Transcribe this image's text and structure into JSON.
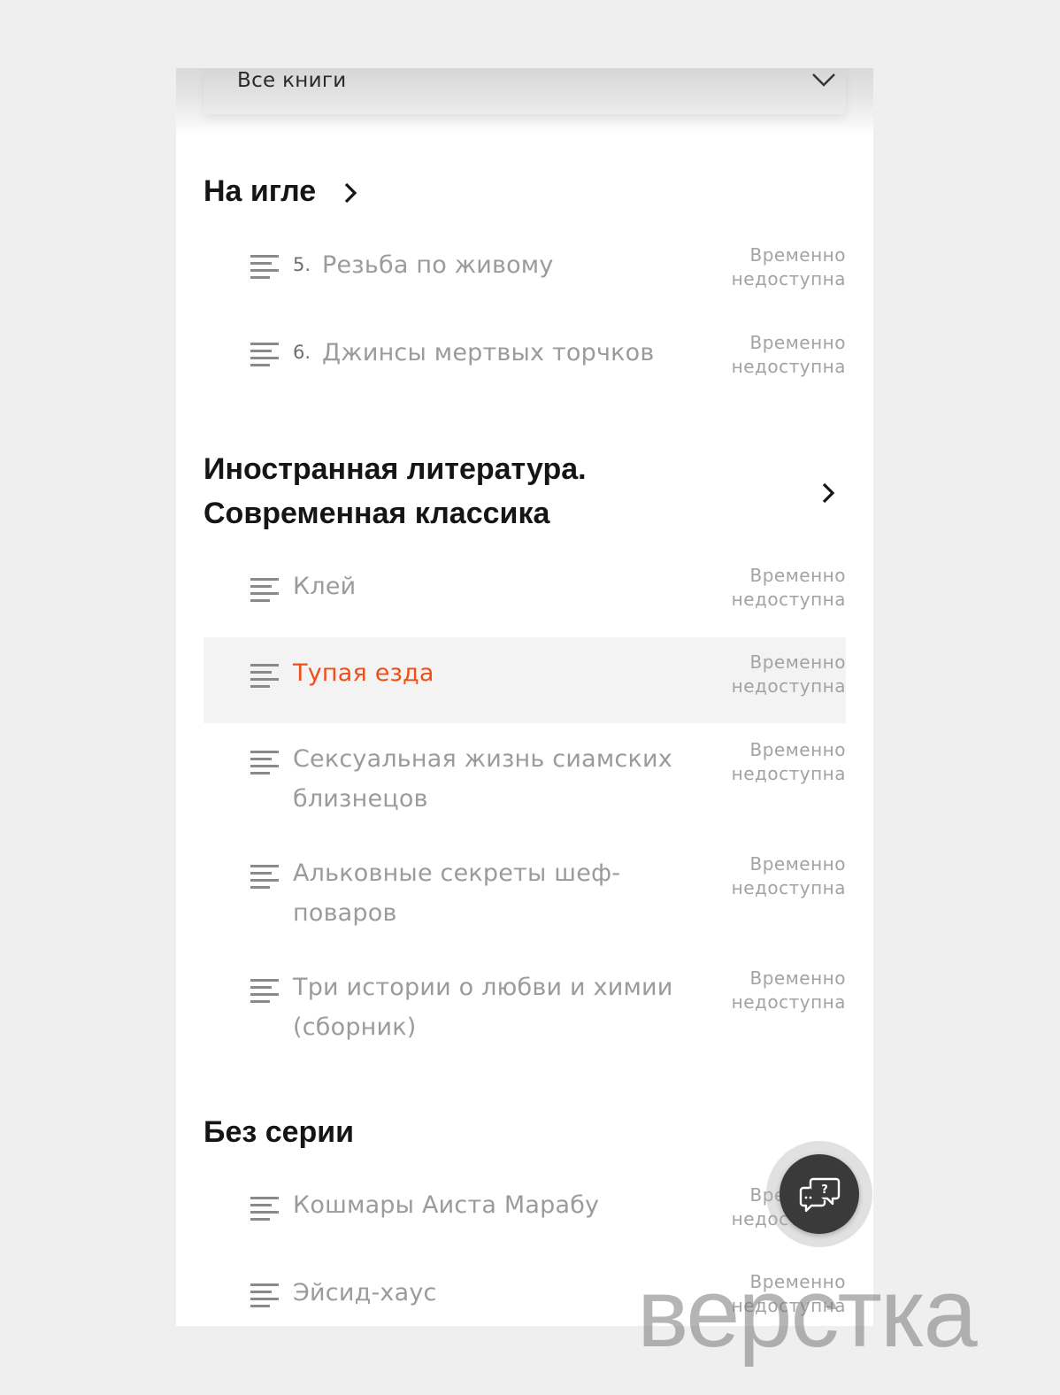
{
  "filter": {
    "label": "Все книги",
    "chevron_icon": "chevron-down-icon"
  },
  "sections": [
    {
      "title": "На игле",
      "items": [
        {
          "number": "5.",
          "title_lines": [
            "Резьба по живому"
          ],
          "status_lines": [
            "Временно",
            "недоступна"
          ]
        },
        {
          "number": "6.",
          "title_lines": [
            "Джинсы мертвых торчков"
          ],
          "status_lines": [
            "Временно",
            "недоступна"
          ]
        }
      ]
    },
    {
      "title_lines": [
        "Иностранная литература.",
        "Современная классика"
      ],
      "items": [
        {
          "title_lines": [
            "Клей"
          ],
          "status_lines": [
            "Временно",
            "недоступна"
          ]
        },
        {
          "title_lines": [
            "Тупая езда"
          ],
          "status_lines": [
            "Временно",
            "недоступна"
          ],
          "active": true
        },
        {
          "title_lines": [
            "Сексуальная жизнь сиамских",
            "близнецов"
          ],
          "status_lines": [
            "Временно",
            "недоступна"
          ]
        },
        {
          "title_lines": [
            "Альковные секреты шеф-",
            "поваров"
          ],
          "status_lines": [
            "Временно",
            "недоступна"
          ]
        },
        {
          "title_lines": [
            "Три истории о любви и химии",
            "(сборник)"
          ],
          "status_lines": [
            "Временно",
            "недоступна"
          ]
        }
      ]
    },
    {
      "title": "Без серии",
      "items": [
        {
          "title_lines": [
            "Кошмары Аиста Марабу"
          ],
          "status_lines": [
            "Временно",
            "недоступна"
          ]
        },
        {
          "title_lines": [
            "Эйсид-хаус"
          ],
          "status_lines": [
            "Временно",
            "недоступна"
          ]
        }
      ]
    }
  ],
  "support_button": {
    "icon": "chat-question-icon"
  },
  "watermark": {
    "text": "верстка"
  },
  "colors": {
    "accent": "#ee4f18",
    "muted_text": "#9b9b9b",
    "heading": "#151515",
    "fab": "#3a3a3a"
  }
}
